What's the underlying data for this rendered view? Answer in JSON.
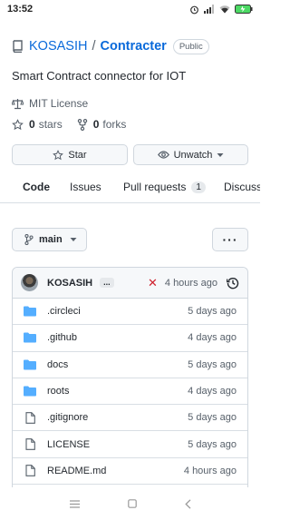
{
  "status_bar": {
    "time": "13:52"
  },
  "repo": {
    "owner": "KOSASIH",
    "separator": "/",
    "name": "Contracter",
    "visibility": "Public",
    "description": "Smart Contract connector for IOT",
    "license": "MIT License",
    "stars_count": "0",
    "stars_label": "stars",
    "forks_count": "0",
    "forks_label": "forks"
  },
  "actions": {
    "star_label": "Star",
    "watch_label": "Unwatch"
  },
  "tabs": [
    {
      "label": "Code"
    },
    {
      "label": "Issues"
    },
    {
      "label": "Pull requests",
      "count": "1"
    },
    {
      "label": "Discuss"
    }
  ],
  "branch": {
    "name": "main",
    "more_label": "···"
  },
  "commit": {
    "author": "KOSASIH",
    "ellipsis": "...",
    "status": "✕",
    "time": "4 hours ago"
  },
  "files": [
    {
      "name": ".circleci",
      "type": "folder",
      "age": "5 days ago"
    },
    {
      "name": ".github",
      "type": "folder",
      "age": "4 days ago"
    },
    {
      "name": "docs",
      "type": "folder",
      "age": "5 days ago"
    },
    {
      "name": "roots",
      "type": "folder",
      "age": "4 days ago"
    },
    {
      "name": ".gitignore",
      "type": "file",
      "age": "5 days ago"
    },
    {
      "name": "LICENSE",
      "type": "file",
      "age": "5 days ago"
    },
    {
      "name": "README.md",
      "type": "file",
      "age": "4 hours ago"
    }
  ],
  "colors": {
    "link": "#0969da",
    "folder": "#54aeff",
    "tab_underline": "#fd8c73",
    "fail": "#cf222e"
  }
}
